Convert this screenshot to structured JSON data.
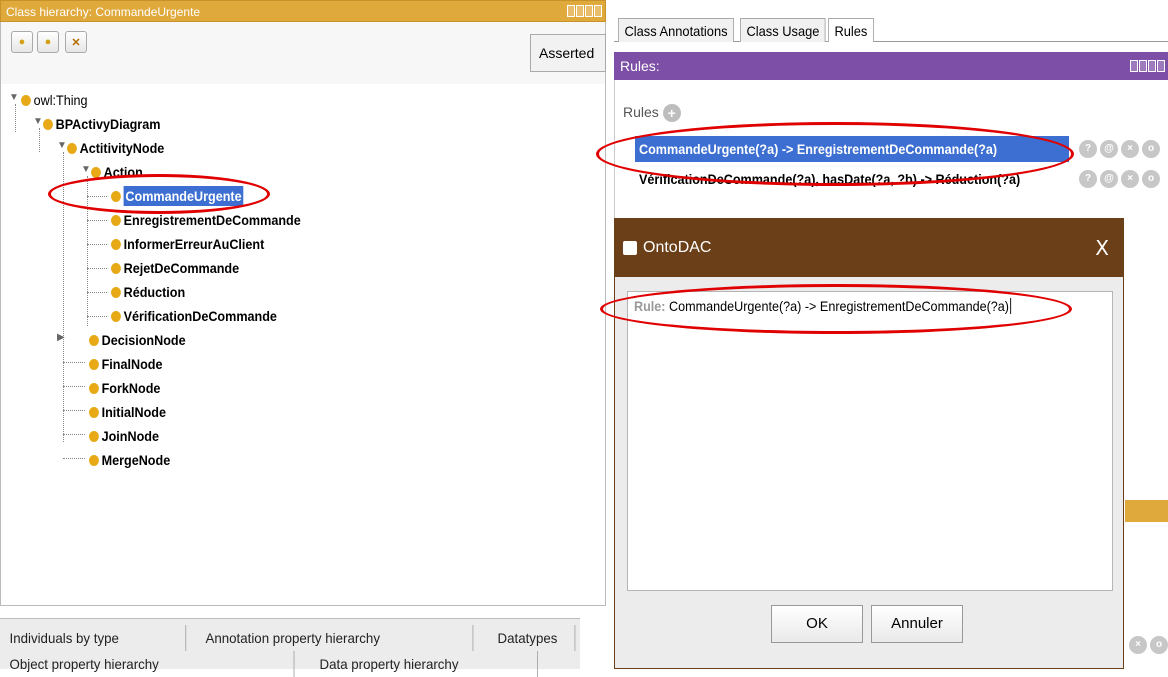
{
  "left_panel": {
    "title": "Class hierarchy: CommandeUrgente",
    "view_select": "Asserted",
    "tree": [
      {
        "label": "owl:Thing",
        "bold": false
      },
      {
        "label": "BPActivyDiagram",
        "bold": true
      },
      {
        "label": "ActitivityNode",
        "bold": true
      },
      {
        "label": "Action",
        "bold": true
      },
      {
        "label": "CommandeUrgente",
        "bold": true,
        "selected": true
      },
      {
        "label": "EnregistrementDeCommande",
        "bold": true
      },
      {
        "label": "InformerErreurAuClient",
        "bold": true
      },
      {
        "label": "RejetDeCommande",
        "bold": true
      },
      {
        "label": "Réduction",
        "bold": true
      },
      {
        "label": "VérificationDeCommande",
        "bold": true
      },
      {
        "label": "DecisionNode",
        "bold": true
      },
      {
        "label": "FinalNode",
        "bold": true
      },
      {
        "label": "ForkNode",
        "bold": true
      },
      {
        "label": "InitialNode",
        "bold": true
      },
      {
        "label": "JoinNode",
        "bold": true
      },
      {
        "label": "MergeNode",
        "bold": true
      }
    ],
    "bottom_tabs_row1": [
      "Individuals by type",
      "Annotation property hierarchy",
      "Datatypes"
    ],
    "bottom_tabs_row2": [
      "Object property hierarchy",
      "Data property hierarchy"
    ]
  },
  "right_panel": {
    "tabs": [
      "Class Annotations",
      "Class Usage",
      "Rules"
    ],
    "active_tab": "Rules",
    "section_title": "Rules:",
    "rules_header": "Rules",
    "rules": [
      {
        "text": "CommandeUrgente(?a) -> EnregistrementDeCommande(?a)",
        "selected": true
      },
      {
        "text": "VérificationDeCommande(?a), hasDate(?a, ?b) -> Réduction(?a)",
        "selected": false
      }
    ]
  },
  "dialog": {
    "title": "OntoDAC",
    "close_glyph": "X",
    "rule_prefix": "Rule:",
    "rule_value": "CommandeUrgente(?a) -> EnregistrementDeCommande(?a)",
    "ok_label": "OK",
    "cancel_label": "Annuler"
  },
  "colors": {
    "accent_orange": "#e0a93c",
    "rules_bar_purple": "#7e4fa6",
    "dialog_title_brown": "#6b3f17",
    "selection_blue": "#3c6fd1",
    "highlight_red": "#e00000"
  }
}
